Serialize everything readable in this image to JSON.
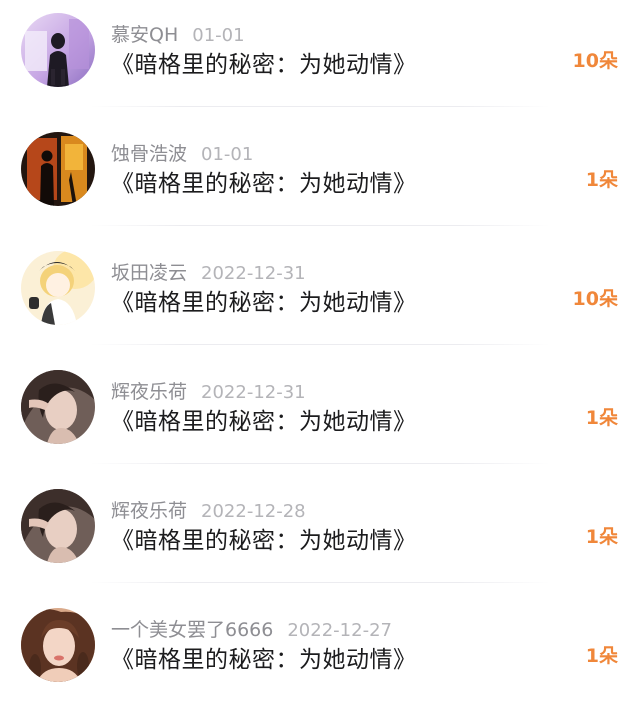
{
  "colors": {
    "gift_accent": "#f0873a",
    "username": "#8e8e93",
    "date": "#b4b4b8",
    "title": "#1c1c1e"
  },
  "gift_records": [
    {
      "username": "慕安QH",
      "date": "01-01",
      "title": "《暗格里的秘密：为她动情》",
      "gift_count": "10朵",
      "avatar_icon": "avatar-girl-neon-street"
    },
    {
      "username": "蚀骨浩波",
      "date": "01-01",
      "title": "《暗格里的秘密：为她动情》",
      "gift_count": "1朵",
      "avatar_icon": "avatar-silhouette-sunset"
    },
    {
      "username": "坂田凌云",
      "date": "2022-12-31",
      "title": "《暗格里的秘密：为她动情》",
      "gift_count": "10朵",
      "avatar_icon": "avatar-anime-boy"
    },
    {
      "username": "辉夜乐荷",
      "date": "2022-12-31",
      "title": "《暗格里的秘密：为她动情》",
      "gift_count": "1朵",
      "avatar_icon": "avatar-woman-portrait"
    },
    {
      "username": "辉夜乐荷",
      "date": "2022-12-28",
      "title": "《暗格里的秘密：为她动情》",
      "gift_count": "1朵",
      "avatar_icon": "avatar-woman-portrait"
    },
    {
      "username": "一个美女罢了6666",
      "date": "2022-12-27",
      "title": "《暗格里的秘密：为她动情》",
      "gift_count": "1朵",
      "avatar_icon": "avatar-woman-selfie"
    }
  ]
}
